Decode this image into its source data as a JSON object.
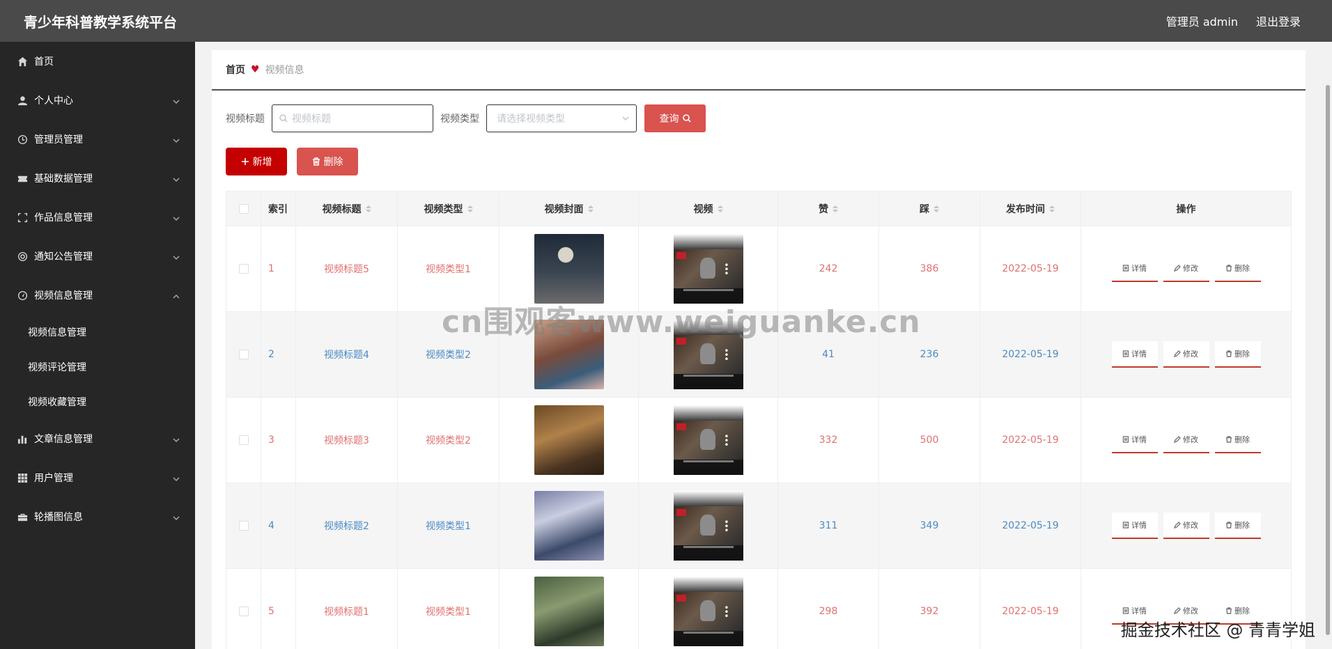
{
  "header": {
    "title": "青少年科普教学系统平台",
    "user": "管理员 admin",
    "logout": "退出登录"
  },
  "sidebar": {
    "items": [
      {
        "label": "首页",
        "icon": "home-icon"
      },
      {
        "label": "个人中心",
        "icon": "user-icon"
      },
      {
        "label": "管理员管理",
        "icon": "clock-icon"
      },
      {
        "label": "基础数据管理",
        "icon": "ticket-icon"
      },
      {
        "label": "作品信息管理",
        "icon": "frame-icon"
      },
      {
        "label": "通知公告管理",
        "icon": "target-icon"
      },
      {
        "label": "视频信息管理",
        "icon": "gauge-icon"
      },
      {
        "label": "文章信息管理",
        "icon": "bar-chart-icon"
      },
      {
        "label": "用户管理",
        "icon": "grid-icon"
      },
      {
        "label": "轮播图信息",
        "icon": "briefcase-icon"
      }
    ],
    "submenu": [
      "视频信息管理",
      "视频评论管理",
      "视频收藏管理"
    ]
  },
  "breadcrumb": {
    "home": "首页",
    "current": "视频信息"
  },
  "search": {
    "title_label": "视频标题",
    "title_placeholder": "视频标题",
    "type_label": "视频类型",
    "type_placeholder": "请选择视频类型",
    "query_button": "查询"
  },
  "actions": {
    "add": "新增",
    "delete": "删除"
  },
  "table": {
    "headers": [
      "索引",
      "视频标题",
      "视频类型",
      "视频封面",
      "视频",
      "赞",
      "踩",
      "发布时间",
      "操作"
    ],
    "op_labels": {
      "detail": "详情",
      "edit": "修改",
      "delete": "删除"
    },
    "rows": [
      {
        "index": "1",
        "title": "视频标题5",
        "type": "视频类型1",
        "like": "242",
        "dislike": "386",
        "date": "2022-05-19",
        "color": "#e07070"
      },
      {
        "index": "2",
        "title": "视频标题4",
        "type": "视频类型2",
        "like": "41",
        "dislike": "236",
        "date": "2022-05-19",
        "color": "#4a8ac4"
      },
      {
        "index": "3",
        "title": "视频标题3",
        "type": "视频类型2",
        "like": "332",
        "dislike": "500",
        "date": "2022-05-19",
        "color": "#e07070"
      },
      {
        "index": "4",
        "title": "视频标题2",
        "type": "视频类型1",
        "like": "311",
        "dislike": "349",
        "date": "2022-05-19",
        "color": "#4a8ac4"
      },
      {
        "index": "5",
        "title": "视频标题1",
        "type": "视频类型1",
        "like": "298",
        "dislike": "392",
        "date": "2022-05-19",
        "color": "#e07070"
      }
    ]
  },
  "watermark": "cn围观客www.weiguanke.cn",
  "watermark2": "掘金技术社区 @ 青青学姐"
}
